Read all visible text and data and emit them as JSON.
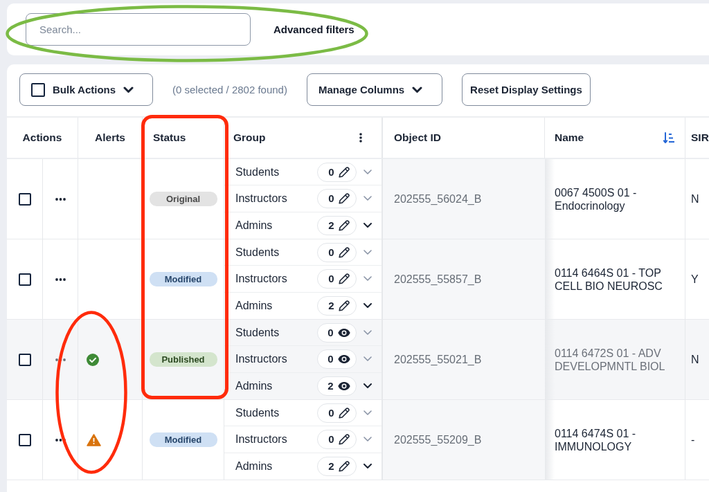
{
  "search": {
    "placeholder": "Search..."
  },
  "advanced_filters": {
    "label": "Advanced filters"
  },
  "toolbar": {
    "bulk_actions": {
      "label": "Bulk Actions",
      "checked": false
    },
    "selection_count": "(0 selected / 2802 found)",
    "manage_columns": {
      "label": "Manage Columns"
    },
    "reset_display_settings": {
      "label": "Reset Display Settings"
    }
  },
  "table": {
    "columns": [
      {
        "label": "Actions"
      },
      {
        "label": "Alerts"
      },
      {
        "label": "Status"
      },
      {
        "label": "Group",
        "menu": true
      },
      {
        "label": "Object ID"
      },
      {
        "label": "Name",
        "sorted": true
      },
      {
        "label": "SIR"
      }
    ],
    "rows": [
      {
        "checked": false,
        "highlighted": false,
        "status": {
          "label": "Original",
          "kind": "original"
        },
        "groups": [
          {
            "name": "Students",
            "count": "0",
            "kind": "edit",
            "expandable": false
          },
          {
            "name": "Instructors",
            "count": "0",
            "kind": "edit",
            "expandable": false
          },
          {
            "name": "Admins",
            "count": "2",
            "kind": "edit",
            "expandable": true
          }
        ],
        "object_id": "202555_56024_B",
        "name": "0067 4500S 01 - Endocrinology",
        "sirs": "N"
      },
      {
        "checked": false,
        "highlighted": false,
        "status": {
          "label": "Modified",
          "kind": "modified"
        },
        "groups": [
          {
            "name": "Students",
            "count": "0",
            "kind": "edit",
            "expandable": false
          },
          {
            "name": "Instructors",
            "count": "0",
            "kind": "edit",
            "expandable": false
          },
          {
            "name": "Admins",
            "count": "2",
            "kind": "edit",
            "expandable": true
          }
        ],
        "object_id": "202555_55857_B",
        "name": "0114 6464S 01 - TOP CELL BIO NEUROSC",
        "sirs": "Y"
      },
      {
        "checked": false,
        "highlighted": true,
        "alert": {
          "kind": "success"
        },
        "status": {
          "label": "Published",
          "kind": "published"
        },
        "groups": [
          {
            "name": "Students",
            "count": "0",
            "kind": "view",
            "expandable": false
          },
          {
            "name": "Instructors",
            "count": "0",
            "kind": "view",
            "expandable": false
          },
          {
            "name": "Admins",
            "count": "2",
            "kind": "view",
            "expandable": true
          }
        ],
        "object_id": "202555_55021_B",
        "name": "0114 6472S 01 - ADV DEVELOPMNTL BIOL",
        "sirs": "N"
      },
      {
        "checked": false,
        "highlighted": false,
        "alert": {
          "kind": "warning"
        },
        "status": {
          "label": "Modified",
          "kind": "modified"
        },
        "groups": [
          {
            "name": "Students",
            "count": "0",
            "kind": "edit",
            "expandable": false
          },
          {
            "name": "Instructors",
            "count": "0",
            "kind": "edit",
            "expandable": false
          },
          {
            "name": "Admins",
            "count": "2",
            "kind": "edit",
            "expandable": true
          }
        ],
        "object_id": "202555_55209_B",
        "name": "0114 6474S 01 - IMMUNOLOGY",
        "sirs": "-"
      }
    ]
  },
  "annotations": [
    {
      "kind": "ellipse",
      "color": "#7bbb45"
    },
    {
      "kind": "rectangle",
      "color": "#ff2b0b"
    },
    {
      "kind": "ellipse",
      "color": "#ff2b0b"
    }
  ]
}
